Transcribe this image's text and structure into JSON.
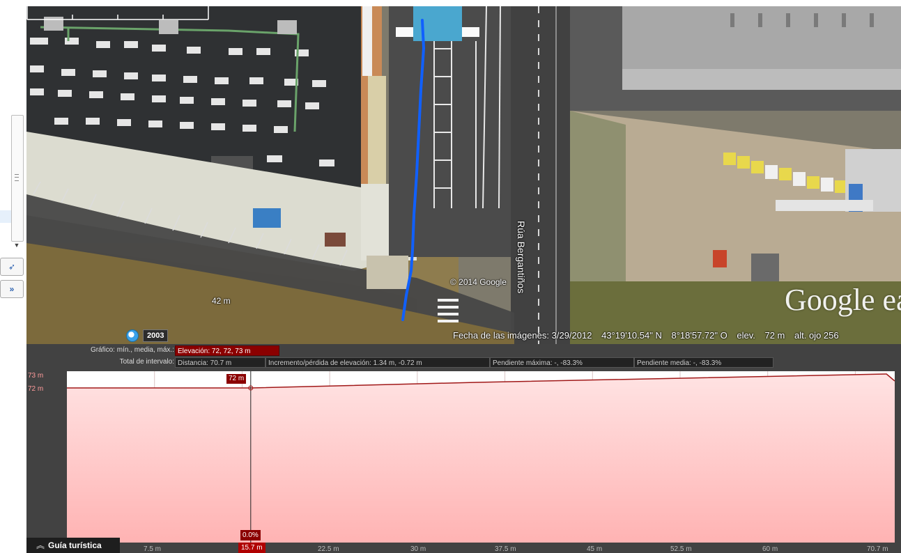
{
  "map": {
    "copyright": "© 2014 Google",
    "road_name": "Rúa Bergantiños",
    "logo": "Google ea",
    "scale_label": "42 m",
    "history_year": "2003",
    "status": {
      "image_date": "Fecha de las imágenes: 3/29/2012",
      "lat": "43°19'10.54\" N",
      "lon": "8°18'57.72\" O",
      "elev_label": "elev.",
      "elev_value": "72 m",
      "eye_alt": "alt. ojo  256"
    }
  },
  "elevation_panel": {
    "graph_label": "Gráfico: mín., media, máx.:",
    "graph_value": "Elevación: 72, 72, 73 m",
    "range_label": "Total de intervalo:",
    "distance": "Distancia: 70.7 m",
    "gain_loss": "Incremento/pérdida de elevación: 1.34 m, -0.72 m",
    "max_slope": "Pendiente máxima: -, -83.3%",
    "avg_slope": "Pendiente media: -, -83.3%",
    "y_top": "73 m",
    "y_bottom": "72 m",
    "cursor_value": "72 m",
    "cursor_slope": "0.0%",
    "cursor_distance": "15.7 m",
    "x_ticks": [
      "7.5 m",
      "15.7 m",
      "22.5 m",
      "30 m",
      "37.5 m",
      "45 m",
      "52.5 m",
      "60 m",
      "70.7 m"
    ]
  },
  "chart_data": {
    "type": "area",
    "xlabel": "",
    "ylabel": "",
    "ylim": [
      72,
      73
    ],
    "x": [
      0,
      15.7,
      35,
      70,
      70.7
    ],
    "values": [
      72,
      72,
      72.4,
      73,
      72.5
    ]
  },
  "tour_guide": {
    "icon": "double-chevron-up-icon",
    "label": "Guía turística"
  }
}
